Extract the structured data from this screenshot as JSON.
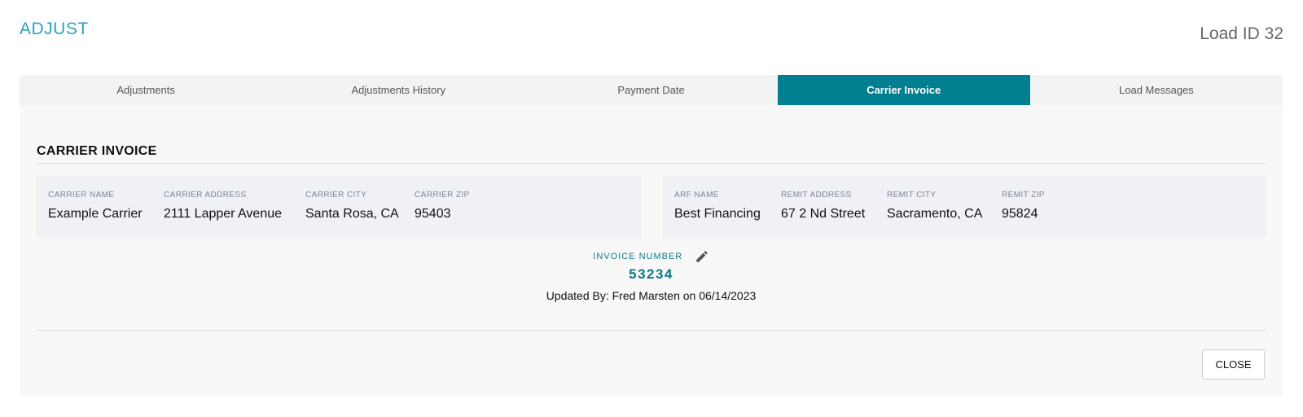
{
  "header": {
    "title": "ADJUST",
    "load_id": "Load ID 32"
  },
  "tabs": [
    {
      "label": "Adjustments",
      "active": false
    },
    {
      "label": "Adjustments History",
      "active": false
    },
    {
      "label": "Payment Date",
      "active": false
    },
    {
      "label": "Carrier Invoice",
      "active": true
    },
    {
      "label": "Load Messages",
      "active": false
    }
  ],
  "section": {
    "title": "CARRIER INVOICE"
  },
  "carrier": {
    "name_label": "CARRIER NAME",
    "name": "Example Carrier",
    "address_label": "CARRIER ADDRESS",
    "address": "2111 Lapper Avenue",
    "city_label": "CARRIER CITY",
    "city": "Santa Rosa, CA",
    "zip_label": "CARRIER ZIP",
    "zip": "95403"
  },
  "remit": {
    "arf_label": "ARF NAME",
    "arf": "Best Financing",
    "address_label": "REMIT ADDRESS",
    "address": "67 2 Nd Street",
    "city_label": "REMIT CITY",
    "city": "Sacramento, CA",
    "zip_label": "REMIT ZIP",
    "zip": "95824"
  },
  "invoice": {
    "label": "INVOICE NUMBER",
    "number": "53234",
    "updated": "Updated By: Fred Marsten on 06/14/2023"
  },
  "actions": {
    "close_label": "CLOSE"
  },
  "colors": {
    "accent": "#007f91",
    "title": "#29a3ba"
  },
  "icons": {
    "edit": "pencil-icon"
  }
}
